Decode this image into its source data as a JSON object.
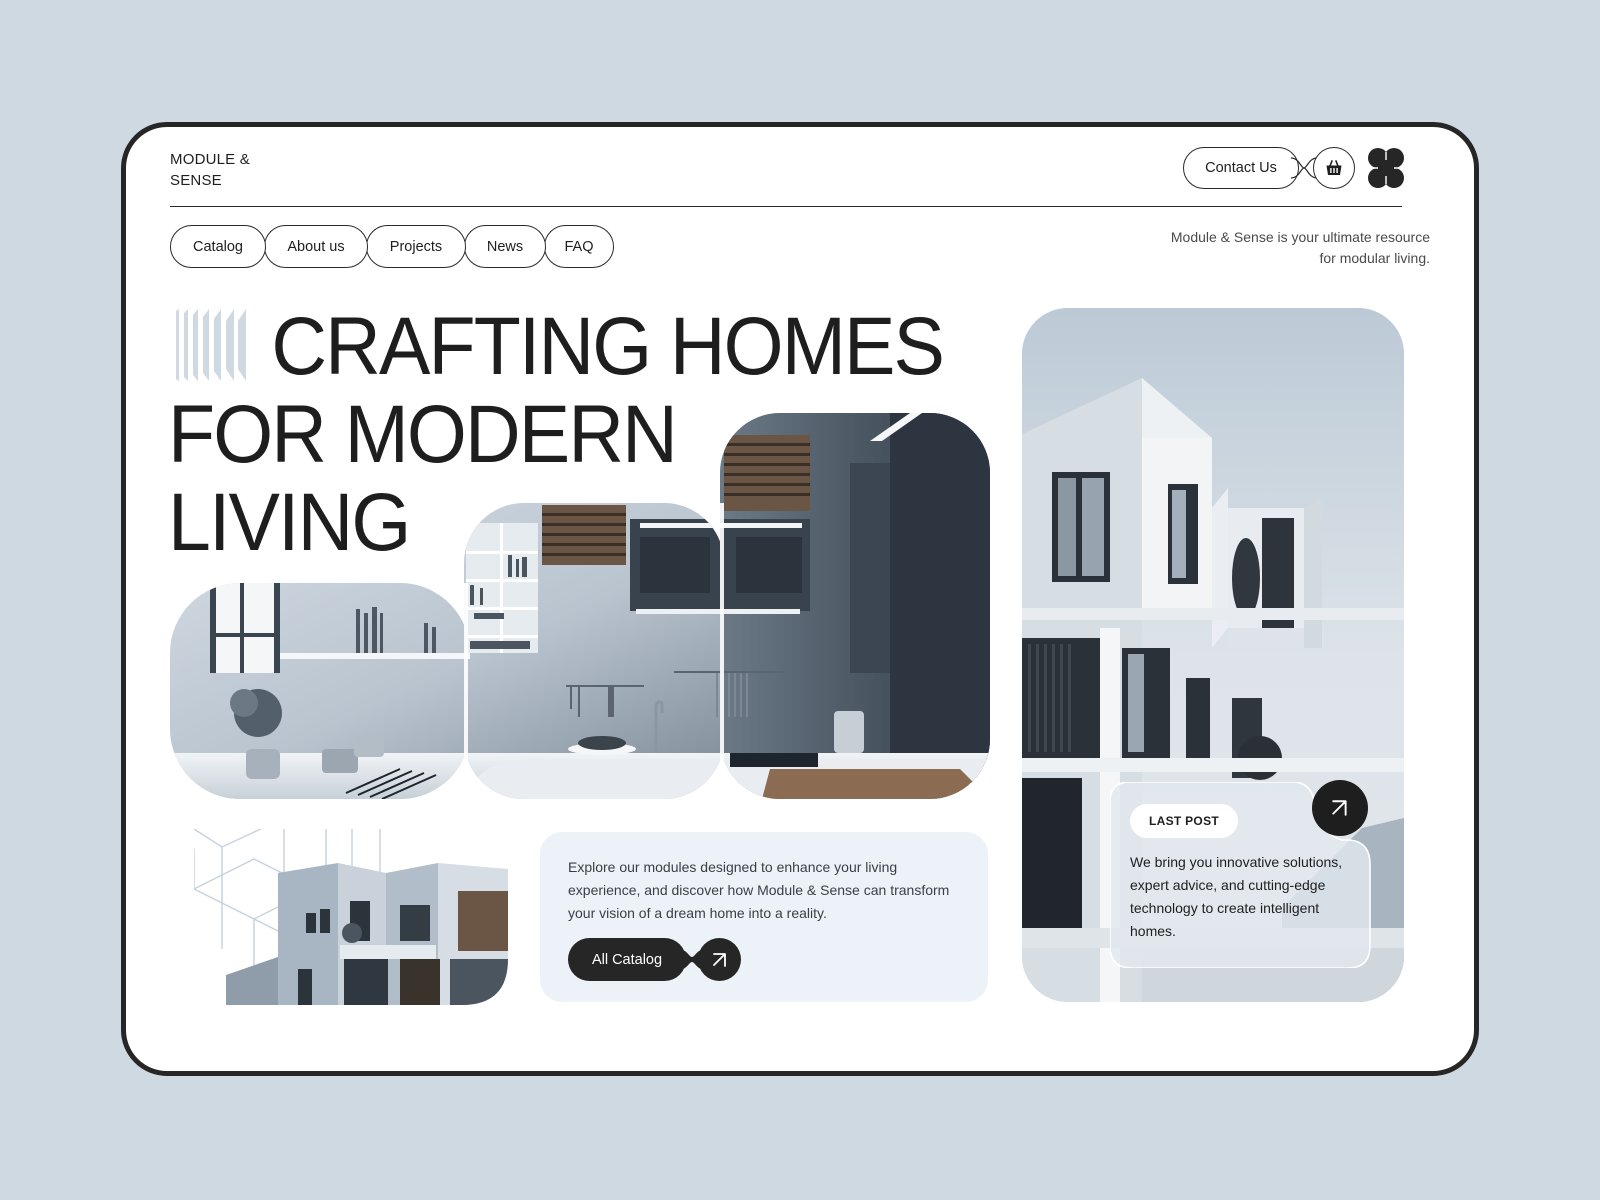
{
  "brand": {
    "line1": "MODULE &",
    "line2": "SENSE"
  },
  "header": {
    "contact_label": "Contact Us",
    "basket_icon": "basket-icon",
    "logo_icon": "flower-logo-icon"
  },
  "nav": {
    "items": [
      {
        "label": "Catalog"
      },
      {
        "label": "About us"
      },
      {
        "label": "Projects"
      },
      {
        "label": "News"
      },
      {
        "label": "FAQ"
      }
    ]
  },
  "tagline": "Module & Sense is your ultimate resource for modular living.",
  "hero": {
    "line1": "CRAFTING HOMES",
    "line2": "FOR MODERN",
    "line3": "LIVING",
    "decor_icon": "stripes-icon"
  },
  "images": {
    "kitchen_alt": "Modern kitchen interior",
    "small_house_alt": "Modular house exterior with wireframe",
    "tall_building_alt": "White modular building facade"
  },
  "info": {
    "text": "Explore our modules designed to enhance your living experience, and discover how Module & Sense can transform your vision of a dream home into a reality.",
    "catalog_label": "All Catalog",
    "arrow_icon": "arrow-up-right-icon"
  },
  "post": {
    "badge": "LAST POST",
    "text": "We bring you innovative solutions, expert advice, and cutting-edge technology to create intelligent homes.",
    "arrow_icon": "arrow-up-right-icon"
  },
  "colors": {
    "background": "#cfd9e2",
    "frame_border": "#262626",
    "dark": "#1e1e1e",
    "info_card_bg": "#edf2f8",
    "accent_blue_grey": "#a9b8c8"
  }
}
